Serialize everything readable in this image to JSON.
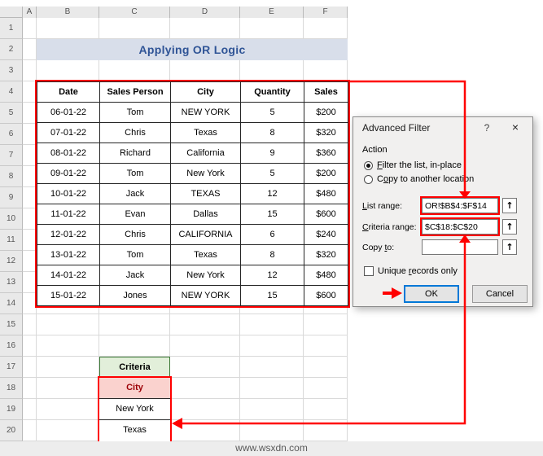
{
  "sheet": {
    "column_headers": [
      "A",
      "B",
      "C",
      "D",
      "E",
      "F"
    ],
    "row_headers": [
      "1",
      "2",
      "3",
      "4",
      "5",
      "6",
      "7",
      "8",
      "9",
      "10",
      "11",
      "12",
      "13",
      "14",
      "15",
      "16",
      "17",
      "18",
      "19",
      "20"
    ],
    "title": "Applying OR Logic",
    "table": {
      "headers": [
        "Date",
        "Sales Person",
        "City",
        "Quantity",
        "Sales"
      ],
      "rows": [
        [
          "06-01-22",
          "Tom",
          "NEW YORK",
          "5",
          "$200"
        ],
        [
          "07-01-22",
          "Chris",
          "Texas",
          "8",
          "$320"
        ],
        [
          "08-01-22",
          "Richard",
          "California",
          "9",
          "$360"
        ],
        [
          "09-01-22",
          "Tom",
          "New York",
          "5",
          "$200"
        ],
        [
          "10-01-22",
          "Jack",
          "TEXAS",
          "12",
          "$480"
        ],
        [
          "11-01-22",
          "Evan",
          "Dallas",
          "15",
          "$600"
        ],
        [
          "12-01-22",
          "Chris",
          "CALIFORNIA",
          "6",
          "$240"
        ],
        [
          "13-01-22",
          "Tom",
          "Texas",
          "8",
          "$320"
        ],
        [
          "14-01-22",
          "Jack",
          "New York",
          "12",
          "$480"
        ],
        [
          "15-01-22",
          "Jones",
          "NEW YORK",
          "15",
          "$600"
        ]
      ]
    },
    "criteria": {
      "title": "Criteria",
      "header": "City",
      "values": [
        "New York",
        "Texas"
      ]
    },
    "watermark": "www.wsxdn.com"
  },
  "dialog": {
    "title": "Advanced Filter",
    "action_label": "Action",
    "radio_filter_in_place": "Filter the list, in-place",
    "radio_copy_to_location": "Copy to another location",
    "filter_in_place_selected": true,
    "list_range_label": "List range:",
    "list_range_value": "OR!$B$4:$F$14",
    "criteria_range_label": "Criteria range:",
    "criteria_range_value": "$C$18:$C$20",
    "copy_to_label": "Copy to:",
    "copy_to_value": "",
    "unique_records_label": "Unique records only",
    "unique_records_checked": false,
    "ok_label": "OK",
    "cancel_label": "Cancel",
    "icons": {
      "help": "?",
      "close": "×",
      "range_selector": "↑"
    }
  },
  "colors": {
    "annotation_red": "#FF0000",
    "title_text": "#2F5496",
    "title_band_bg": "#D8DEEA",
    "criteria_title_bg": "#E2EFDA",
    "criteria_header_bg": "#FAD2CE",
    "criteria_header_text": "#9C0006",
    "ok_focus_border": "#0078D7",
    "dialog_bg": "#F1F0EF"
  }
}
